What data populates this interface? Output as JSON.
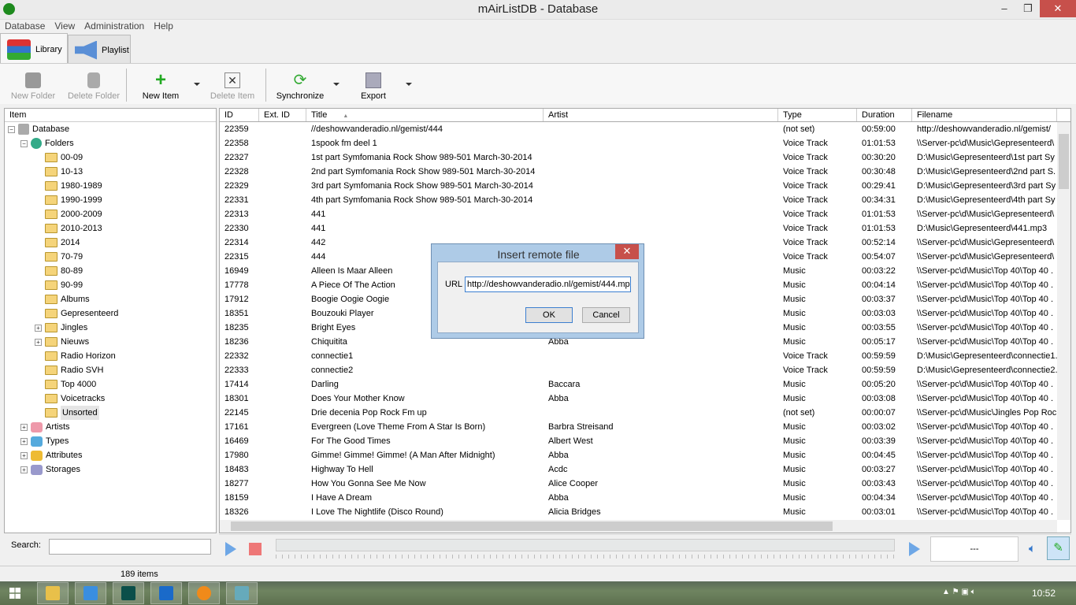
{
  "window": {
    "title": "mAirListDB - Database",
    "minimize": "–",
    "restore": "❐",
    "close": "✕"
  },
  "menu": [
    "Database",
    "View",
    "Administration",
    "Help"
  ],
  "tabs": [
    {
      "label": "Library",
      "active": true
    },
    {
      "label": "Playlist",
      "active": false
    }
  ],
  "toolbar": {
    "new_folder": "New Folder",
    "delete_folder": "Delete Folder",
    "new_item": "New Item",
    "delete_item": "Delete Item",
    "synchronize": "Synchronize",
    "export": "Export"
  },
  "tree": {
    "header": "Item",
    "root": "Database",
    "folders_label": "Folders",
    "folders": [
      {
        "label": "00-09"
      },
      {
        "label": "10-13"
      },
      {
        "label": "1980-1989"
      },
      {
        "label": "1990-1999"
      },
      {
        "label": "2000-2009"
      },
      {
        "label": "2010-2013"
      },
      {
        "label": "2014"
      },
      {
        "label": "70-79"
      },
      {
        "label": "80-89"
      },
      {
        "label": "90-99"
      },
      {
        "label": "Albums"
      },
      {
        "label": "Gepresenteerd"
      },
      {
        "label": "Jingles",
        "expandable": true
      },
      {
        "label": "Nieuws",
        "expandable": true
      },
      {
        "label": "Radio  Horizon"
      },
      {
        "label": "Radio SVH"
      },
      {
        "label": "Top 4000"
      },
      {
        "label": "Voicetracks"
      },
      {
        "label": "Unsorted",
        "selected": true
      }
    ],
    "others": [
      "Artists",
      "Types",
      "Attributes",
      "Storages"
    ]
  },
  "grid": {
    "columns": [
      "ID",
      "Ext. ID",
      "Title",
      "Artist",
      "Type",
      "Duration",
      "Filename"
    ],
    "sort_column": "Title",
    "sort_indicator": "▲",
    "rows": [
      [
        "22359",
        "",
        "//deshowvanderadio.nl/gemist/444",
        "",
        "(not set)",
        "00:59:00",
        "http://deshowvanderadio.nl/gemist/"
      ],
      [
        "22358",
        "",
        "1spook fm deel 1",
        "",
        "Voice Track",
        "01:01:53",
        "\\\\Server-pc\\d\\Music\\Gepresenteerd\\"
      ],
      [
        "22327",
        "",
        "1st part Symfomania Rock Show 989-501 March-30-2014",
        "",
        "Voice Track",
        "00:30:20",
        "D:\\Music\\Gepresenteerd\\1st part Sy"
      ],
      [
        "22328",
        "",
        "2nd part Symfomania Rock Show 989-501 March-30-2014",
        "",
        "Voice Track",
        "00:30:48",
        "D:\\Music\\Gepresenteerd\\2nd part S."
      ],
      [
        "22329",
        "",
        "3rd part Symfomania Rock Show 989-501 March-30-2014",
        "",
        "Voice Track",
        "00:29:41",
        "D:\\Music\\Gepresenteerd\\3rd part Sy"
      ],
      [
        "22331",
        "",
        "4th part Symfomania Rock Show 989-501 March-30-2014",
        "",
        "Voice Track",
        "00:34:31",
        "D:\\Music\\Gepresenteerd\\4th part Sy"
      ],
      [
        "22313",
        "",
        "441",
        "",
        "Voice Track",
        "01:01:53",
        "\\\\Server-pc\\d\\Music\\Gepresenteerd\\"
      ],
      [
        "22330",
        "",
        "441",
        "",
        "Voice Track",
        "01:01:53",
        "D:\\Music\\Gepresenteerd\\441.mp3"
      ],
      [
        "22314",
        "",
        "442",
        "",
        "Voice Track",
        "00:52:14",
        "\\\\Server-pc\\d\\Music\\Gepresenteerd\\"
      ],
      [
        "22315",
        "",
        "444",
        "",
        "Voice Track",
        "00:54:07",
        "\\\\Server-pc\\d\\Music\\Gepresenteerd\\"
      ],
      [
        "16949",
        "",
        "Alleen Is Maar Alleen",
        "",
        "Music",
        "00:03:22",
        "\\\\Server-pc\\d\\Music\\Top 40\\Top 40 ."
      ],
      [
        "17778",
        "",
        "A Piece Of The Action",
        "",
        "Music",
        "00:04:14",
        "\\\\Server-pc\\d\\Music\\Top 40\\Top 40 ."
      ],
      [
        "17912",
        "",
        "Boogie Oogie Oogie",
        "",
        "Music",
        "00:03:37",
        "\\\\Server-pc\\d\\Music\\Top 40\\Top 40 ."
      ],
      [
        "18351",
        "",
        "Bouzouki Player",
        "",
        "Music",
        "00:03:03",
        "\\\\Server-pc\\d\\Music\\Top 40\\Top 40 ."
      ],
      [
        "18235",
        "",
        "Bright Eyes",
        "",
        "Music",
        "00:03:55",
        "\\\\Server-pc\\d\\Music\\Top 40\\Top 40 ."
      ],
      [
        "18236",
        "",
        "Chiquitita",
        "Abba",
        "Music",
        "00:05:17",
        "\\\\Server-pc\\d\\Music\\Top 40\\Top 40 ."
      ],
      [
        "22332",
        "",
        "connectie1",
        "",
        "Voice Track",
        "00:59:59",
        "D:\\Music\\Gepresenteerd\\connectie1."
      ],
      [
        "22333",
        "",
        "connectie2",
        "",
        "Voice Track",
        "00:59:59",
        "D:\\Music\\Gepresenteerd\\connectie2."
      ],
      [
        "17414",
        "",
        "Darling",
        "Baccara",
        "Music",
        "00:05:20",
        "\\\\Server-pc\\d\\Music\\Top 40\\Top 40 ."
      ],
      [
        "18301",
        "",
        "Does Your Mother Know",
        "Abba",
        "Music",
        "00:03:08",
        "\\\\Server-pc\\d\\Music\\Top 40\\Top 40 ."
      ],
      [
        "22145",
        "",
        "Drie decenia Pop Rock Fm up",
        "",
        "(not set)",
        "00:00:07",
        "\\\\Server-pc\\d\\Music\\Jingles Pop Roc."
      ],
      [
        "17161",
        "",
        "Evergreen (Love Theme From A Star Is Born)",
        "Barbra Streisand",
        "Music",
        "00:03:02",
        "\\\\Server-pc\\d\\Music\\Top 40\\Top 40 ."
      ],
      [
        "16469",
        "",
        "For The Good Times",
        "Albert West",
        "Music",
        "00:03:39",
        "\\\\Server-pc\\d\\Music\\Top 40\\Top 40 ."
      ],
      [
        "17980",
        "",
        "Gimme! Gimme! Gimme! (A Man After Midnight)",
        "Abba",
        "Music",
        "00:04:45",
        "\\\\Server-pc\\d\\Music\\Top 40\\Top 40 ."
      ],
      [
        "18483",
        "",
        "Highway To Hell",
        "Acdc",
        "Music",
        "00:03:27",
        "\\\\Server-pc\\d\\Music\\Top 40\\Top 40 ."
      ],
      [
        "18277",
        "",
        "How You Gonna See Me Now",
        "Alice Cooper",
        "Music",
        "00:03:43",
        "\\\\Server-pc\\d\\Music\\Top 40\\Top 40 ."
      ],
      [
        "18159",
        "",
        "I Have A Dream",
        "Abba",
        "Music",
        "00:04:34",
        "\\\\Server-pc\\d\\Music\\Top 40\\Top 40 ."
      ],
      [
        "18326",
        "",
        "I Love The Nightlife (Disco Round)",
        "Alicia Bridges",
        "Music",
        "00:03:01",
        "\\\\Server-pc\\d\\Music\\Top 40\\Top 40 ."
      ]
    ]
  },
  "search": {
    "label": "Search:",
    "value": ""
  },
  "player": {
    "time_display": "---"
  },
  "status": {
    "items": "189 items"
  },
  "dialog": {
    "title": "Insert remote file",
    "url_label": "URL",
    "url_value": "http://deshowvanderadio.nl/gemist/444.mp3",
    "ok": "OK",
    "cancel": "Cancel",
    "close": "✕"
  },
  "taskbar": {
    "clock": "10:52",
    "apps": [
      "file-explorer",
      "internet-explorer",
      "adobe-audition",
      "outlook",
      "mairlist",
      "paint"
    ]
  },
  "colors": {
    "accent": "#3c7fd0",
    "close": "#c7504b",
    "dialog_frame": "#aecbe7"
  }
}
